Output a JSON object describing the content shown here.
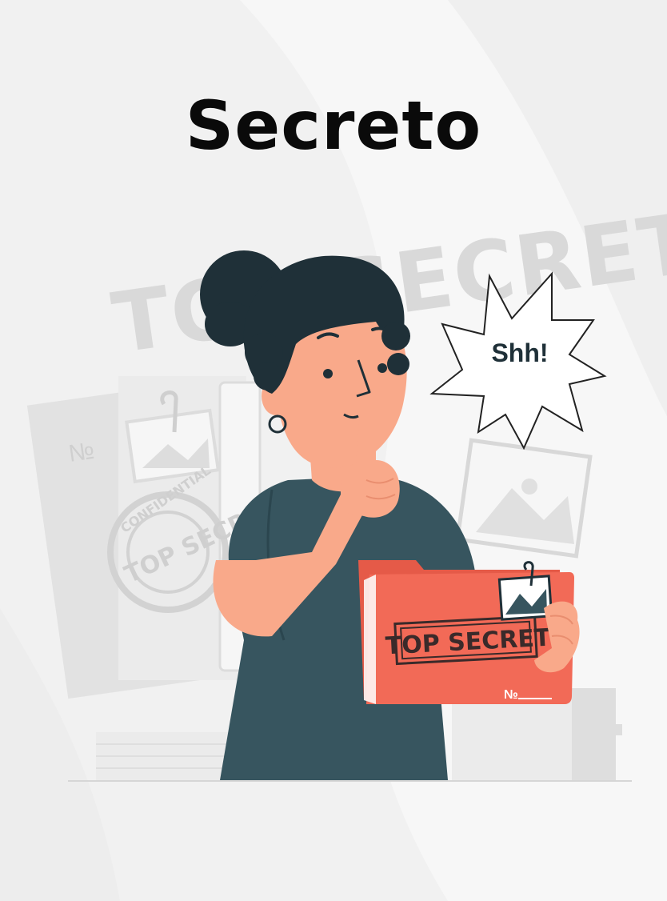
{
  "title": "Secreto",
  "speech_bubble": "Shh!",
  "background_stamp": "TOP SECRET",
  "folder_stamp": "TOP SECRET",
  "folder_number_label": "№",
  "paper_number_label": "№",
  "round_stamp_ring_text": "CONFIDENTIAL",
  "round_stamp_center_text": "TOP SECRET",
  "colors": {
    "background": "#f1f1f1",
    "hair": "#1f3038",
    "skin": "#f9a98a",
    "shirt": "#37555f",
    "folder": "#f26a57",
    "stamp_gray": "#d9d9d9"
  }
}
